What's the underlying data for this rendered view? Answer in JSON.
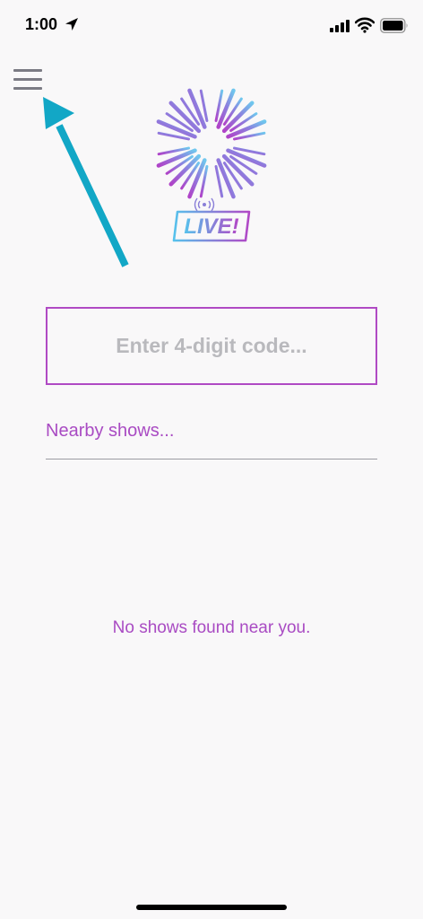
{
  "status_bar": {
    "time": "1:00",
    "icons": [
      "location-arrow-icon",
      "cellular-signal-icon",
      "wifi-icon",
      "battery-icon"
    ]
  },
  "header": {
    "menu_icon": "hamburger-menu-icon",
    "logo_icon": "live-logo-icon",
    "logo_text": "LIVE!"
  },
  "code_entry": {
    "placeholder": "Enter 4-digit code...",
    "value": ""
  },
  "nearby": {
    "title": "Nearby shows...",
    "empty_message": "No shows found near you."
  },
  "colors": {
    "accent": "#a94bc3",
    "annotation_arrow": "#12a7c6",
    "background": "#f9f8f9"
  }
}
